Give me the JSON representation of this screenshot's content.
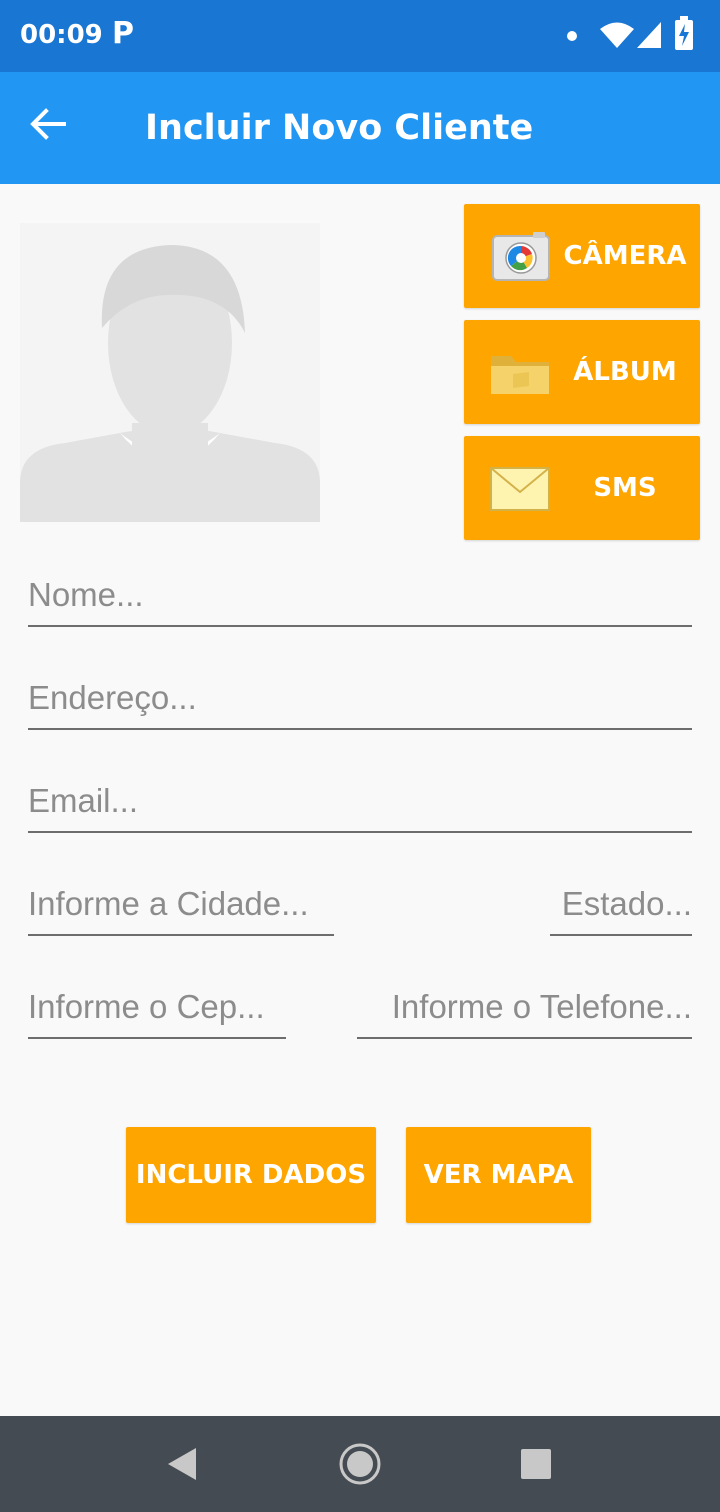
{
  "status_bar": {
    "time": "00:09",
    "notification_letter": "P"
  },
  "app_bar": {
    "title": "Incluir Novo Cliente",
    "back_icon": "arrow-back-icon"
  },
  "photo": {
    "icon": "person-placeholder-icon"
  },
  "side_buttons": {
    "camera": {
      "label": "CÂMERA",
      "icon": "camera-icon"
    },
    "album": {
      "label": "ÁLBUM",
      "icon": "folder-icon"
    },
    "sms": {
      "label": "SMS",
      "icon": "envelope-icon"
    }
  },
  "form": {
    "nome": {
      "placeholder": "Nome...",
      "value": ""
    },
    "endereco": {
      "placeholder": "Endereço...",
      "value": ""
    },
    "email": {
      "placeholder": "Email...",
      "value": ""
    },
    "cidade": {
      "placeholder": "Informe a Cidade...",
      "value": ""
    },
    "estado": {
      "placeholder": "Estado...",
      "value": ""
    },
    "cep": {
      "placeholder": "Informe o Cep...",
      "value": ""
    },
    "telefone": {
      "placeholder": "Informe o Telefone...",
      "value": ""
    }
  },
  "actions": {
    "incluir_label": "INCLUIR DADOS",
    "mapa_label": "VER MAPA"
  },
  "colors": {
    "status_bar": "#1976d2",
    "app_bar": "#2196f3",
    "accent_button": "#ffa500",
    "nav_bar": "#454b52"
  }
}
